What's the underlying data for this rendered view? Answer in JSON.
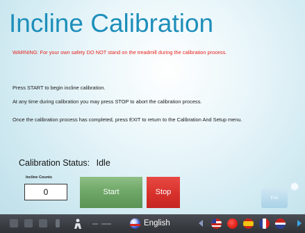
{
  "screen": {
    "title": "Incline Calibration",
    "warning": "WARNING: For your own safety DO NOT stand on the treadmill during the calibration process.",
    "instructions": [
      "Press START to begin incline calibration.",
      "At any time during calibration you may press STOP to abort the calibration process.",
      "Once the calibration process has completed, press EXIT to return to the Calibration And Setup menu."
    ]
  },
  "status": {
    "label": "Calibration Status:",
    "value": "Idle"
  },
  "incline_counts": {
    "label": "Incline Counts",
    "value": "0"
  },
  "buttons": {
    "start": "Start",
    "stop": "Stop",
    "exit": "Exit"
  },
  "taskbar": {
    "language": "English",
    "icons": [
      "window-icon",
      "window-icon",
      "window-icon",
      "person-icon",
      "line-icon",
      "globe-icon"
    ],
    "flags": [
      "us-flag-icon",
      "red-flag-icon",
      "spain-flag-icon",
      "france-flag-icon",
      "uk-flag-icon"
    ]
  },
  "colors": {
    "title": "#1e8fba",
    "warning": "#e8201c",
    "start": "#6fa868",
    "stop": "#d8312c",
    "exit": "#a9d2e7",
    "taskbar": "#3a3d42"
  }
}
